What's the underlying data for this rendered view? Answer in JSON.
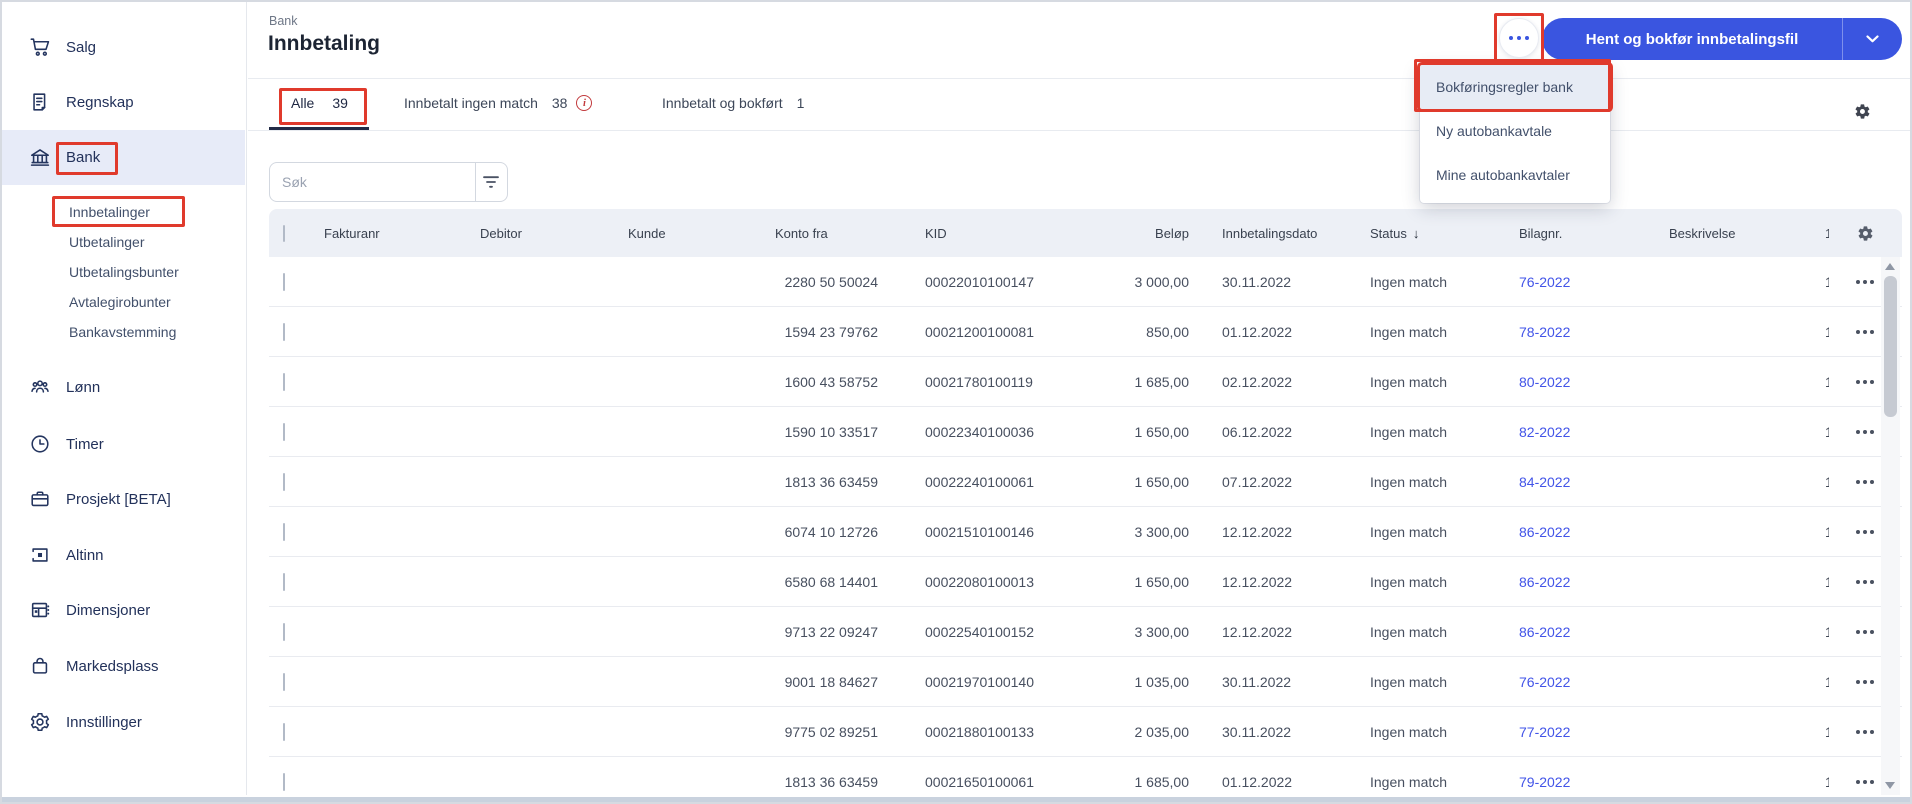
{
  "colors": {
    "accent_blue": "#3a55e0",
    "annotation_red": "#e03a2c",
    "link_blue": "#4254e8",
    "sidebar_active_bg": "#e7ebf8",
    "menu_highlight_bg": "#e7ecf5",
    "table_header_bg": "#edf0f6"
  },
  "sidebar": {
    "items": [
      {
        "label": "Salg",
        "icon": "cart"
      },
      {
        "label": "Regnskap",
        "icon": "document"
      },
      {
        "label": "Bank",
        "icon": "bank"
      },
      {
        "label": "Lønn",
        "icon": "people"
      },
      {
        "label": "Timer",
        "icon": "clock"
      },
      {
        "label": "Prosjekt [BETA]",
        "icon": "briefcase"
      },
      {
        "label": "Altinn",
        "icon": "square-dot"
      },
      {
        "label": "Dimensjoner",
        "icon": "grid"
      },
      {
        "label": "Markedsplass",
        "icon": "bag"
      },
      {
        "label": "Innstillinger",
        "icon": "gear"
      }
    ],
    "bank_subitems": [
      {
        "label": "Innbetalinger"
      },
      {
        "label": "Utbetalinger"
      },
      {
        "label": "Utbetalingsbunter"
      },
      {
        "label": "Avtalegirobunter"
      },
      {
        "label": "Bankavstemming"
      }
    ]
  },
  "header": {
    "breadcrumb": "Bank",
    "title": "Innbetaling",
    "primary_button": "Hent og bokfør innbetalingsfil"
  },
  "menu": {
    "items": [
      "Bokføringsregler bank",
      "Ny autobankavtale",
      "Mine autobankavtaler"
    ]
  },
  "tabs": [
    {
      "label": "Alle",
      "count": "39"
    },
    {
      "label": "Innbetalt ingen match",
      "count": "38"
    },
    {
      "label": "Innbetalt og bokført",
      "count": "1"
    }
  ],
  "search": {
    "placeholder": "Søk"
  },
  "table": {
    "columns": [
      "Fakturanr",
      "Debitor",
      "Kunde",
      "Konto fra",
      "KID",
      "Beløp",
      "Innbetalingsdato",
      "Status",
      "Bilagnr.",
      "Beskrivelse"
    ],
    "sort_column": "Status",
    "sort_indicator": "↓",
    "truncated_column_text": "1",
    "rows": [
      {
        "konto": "2280 50 50024",
        "kid": "00022010100147",
        "belop": "3 000,00",
        "dato": "30.11.2022",
        "status": "Ingen match",
        "bilagnr": "76-2022"
      },
      {
        "konto": "1594 23 79762",
        "kid": "00021200100081",
        "belop": "850,00",
        "dato": "01.12.2022",
        "status": "Ingen match",
        "bilagnr": "78-2022"
      },
      {
        "konto": "1600 43 58752",
        "kid": "00021780100119",
        "belop": "1 685,00",
        "dato": "02.12.2022",
        "status": "Ingen match",
        "bilagnr": "80-2022"
      },
      {
        "konto": "1590 10 33517",
        "kid": "00022340100036",
        "belop": "1 650,00",
        "dato": "06.12.2022",
        "status": "Ingen match",
        "bilagnr": "82-2022"
      },
      {
        "konto": "1813 36 63459",
        "kid": "00022240100061",
        "belop": "1 650,00",
        "dato": "07.12.2022",
        "status": "Ingen match",
        "bilagnr": "84-2022"
      },
      {
        "konto": "6074 10 12726",
        "kid": "00021510100146",
        "belop": "3 300,00",
        "dato": "12.12.2022",
        "status": "Ingen match",
        "bilagnr": "86-2022"
      },
      {
        "konto": "6580 68 14401",
        "kid": "00022080100013",
        "belop": "1 650,00",
        "dato": "12.12.2022",
        "status": "Ingen match",
        "bilagnr": "86-2022"
      },
      {
        "konto": "9713 22 09247",
        "kid": "00022540100152",
        "belop": "3 300,00",
        "dato": "12.12.2022",
        "status": "Ingen match",
        "bilagnr": "86-2022"
      },
      {
        "konto": "9001 18 84627",
        "kid": "00021970100140",
        "belop": "1 035,00",
        "dato": "30.11.2022",
        "status": "Ingen match",
        "bilagnr": "76-2022"
      },
      {
        "konto": "9775 02 89251",
        "kid": "00021880100133",
        "belop": "2 035,00",
        "dato": "30.11.2022",
        "status": "Ingen match",
        "bilagnr": "77-2022"
      },
      {
        "konto": "1813 36 63459",
        "kid": "00021650100061",
        "belop": "1 685,00",
        "dato": "01.12.2022",
        "status": "Ingen match",
        "bilagnr": "79-2022"
      }
    ]
  }
}
